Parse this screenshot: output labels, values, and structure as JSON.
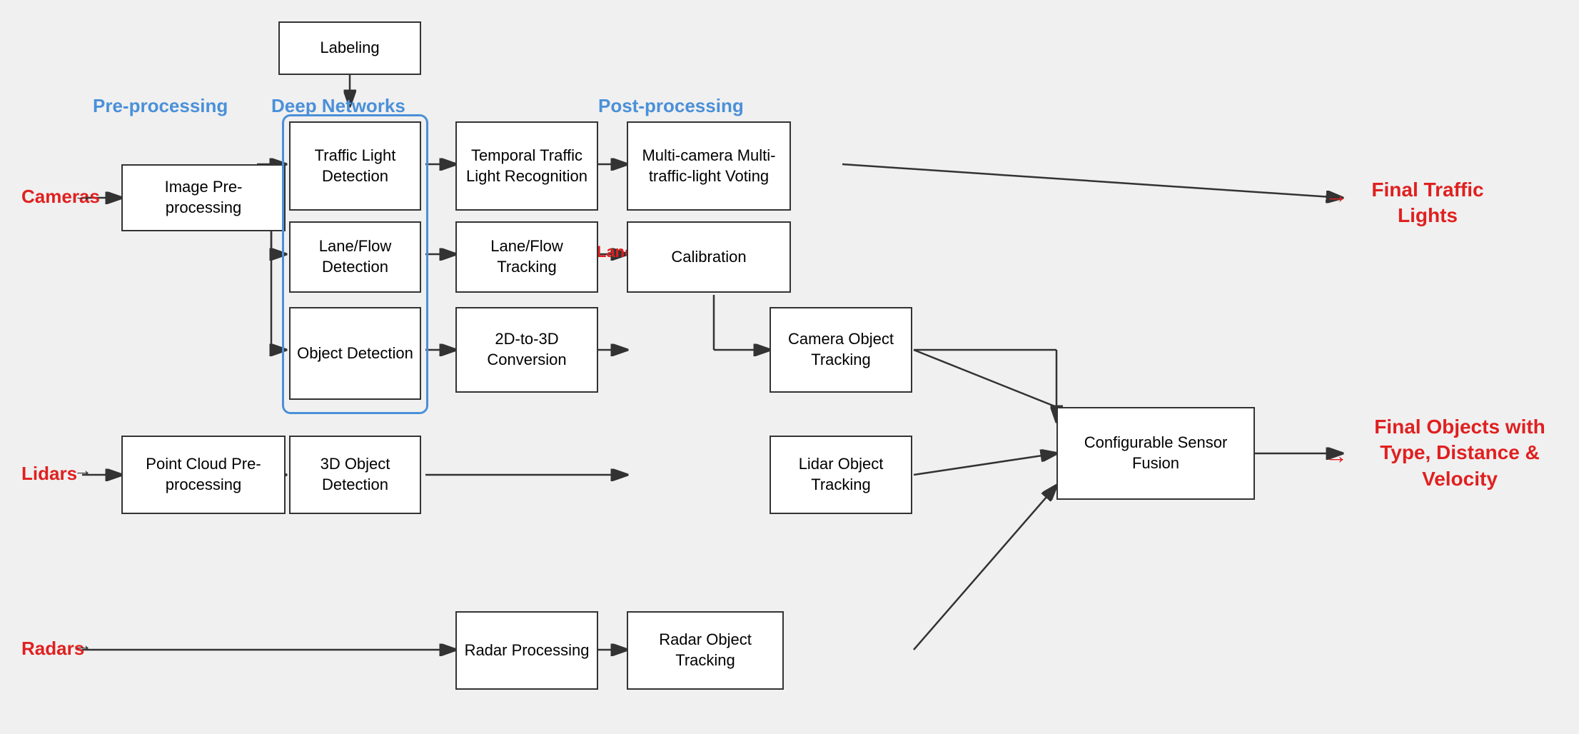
{
  "labels": {
    "preprocessing": "Pre-processing",
    "deep_networks": "Deep Networks",
    "post_processing": "Post-processing",
    "cameras": "Cameras",
    "lidars": "Lidars",
    "radars": "Radars",
    "final_traffic_lights": "Final\nTraffic Lights",
    "final_objects": "Final Objects\nwith Type,\nDistance &\nVelocity",
    "lane_label": "Lane"
  },
  "boxes": {
    "labeling": "Labeling",
    "image_preprocessing": "Image\nPre-processing",
    "traffic_light_detection": "Traffic Light\nDetection",
    "lane_flow_detection": "Lane/Flow\nDetection",
    "object_detection": "Object\nDetection",
    "three_d_object_detection": "3D Object\nDetection",
    "temporal_traffic": "Temporal Traffic\nLight Recognition",
    "lane_flow_tracking": "Lane/Flow\nTracking",
    "two_d_to_3d": "2D-to-3D\nConversion",
    "multi_camera": "Multi-camera\nMulti-traffic-light\nVoting",
    "calibration": "Calibration",
    "camera_object_tracking": "Camera Object\nTracking",
    "lidar_object_tracking": "Lidar Object\nTracking",
    "configurable_sensor": "Configurable\nSensor Fusion",
    "radar_processing": "Radar\nProcessing",
    "radar_object_tracking": "Radar Object\nTracking",
    "point_cloud": "Point Cloud\nPre-processing"
  }
}
